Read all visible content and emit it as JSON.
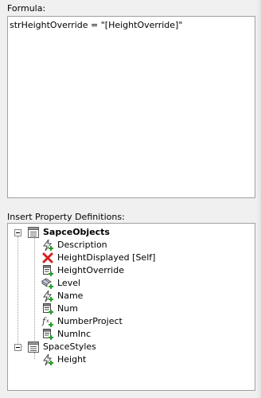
{
  "formula": {
    "label": "Formula:",
    "value": "strHeightOverride = \"[HeightOverride]\""
  },
  "properties": {
    "label": "Insert Property Definitions:",
    "groups": [
      {
        "name": "SapceObjects",
        "items": [
          {
            "label": "Description",
            "icon": "automatic-property-icon"
          },
          {
            "label": "HeightDisplayed [Self]",
            "icon": "error-x-icon"
          },
          {
            "label": "HeightOverride",
            "icon": "manual-property-icon"
          },
          {
            "label": "Level",
            "icon": "level-property-icon"
          },
          {
            "label": "Name",
            "icon": "automatic-property-icon"
          },
          {
            "label": "Num",
            "icon": "manual-property-icon"
          },
          {
            "label": "NumberProject",
            "icon": "formula-property-icon"
          },
          {
            "label": "NumInc",
            "icon": "manual-property-icon"
          }
        ]
      },
      {
        "name": "SpaceStyles",
        "items": [
          {
            "label": "Height",
            "icon": "automatic-property-icon"
          }
        ]
      }
    ]
  }
}
